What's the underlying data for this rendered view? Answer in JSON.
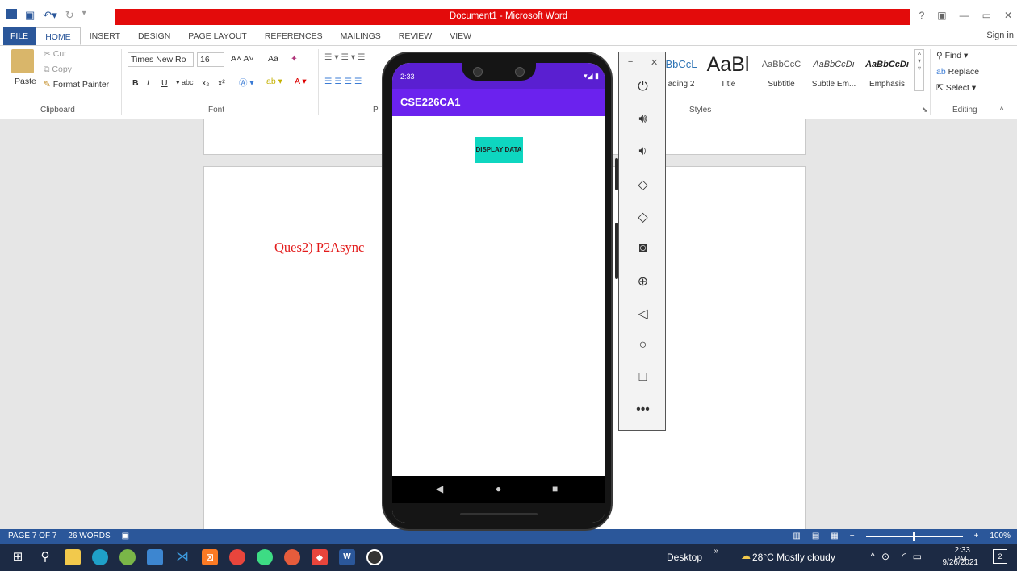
{
  "window": {
    "title": "Document1 - Microsoft Word",
    "sign_in": "Sign in"
  },
  "tabs": [
    "FILE",
    "HOME",
    "INSERT",
    "DESIGN",
    "PAGE LAYOUT",
    "REFERENCES",
    "MAILINGS",
    "REVIEW",
    "VIEW"
  ],
  "clipboard": {
    "paste": "Paste",
    "cut": "Cut",
    "copy": "Copy",
    "format_painter": "Format Painter",
    "label": "Clipboard"
  },
  "font": {
    "name": "Times New Ro",
    "size": "16",
    "label": "Font",
    "case": "Aa"
  },
  "paragraph": {
    "label": "P"
  },
  "styles": {
    "label": "Styles",
    "items": [
      {
        "preview": "BbCcL",
        "name": "ading 2"
      },
      {
        "preview": "AaBl",
        "name": "Title"
      },
      {
        "preview": "AaBbCcC",
        "name": "Subtitle"
      },
      {
        "preview": "AaBbCcDı",
        "name": "Subtle Em..."
      },
      {
        "preview": "AaBbCcDı",
        "name": "Emphasis"
      }
    ]
  },
  "editing": {
    "find": "Find",
    "replace": "Replace",
    "select": "Select",
    "label": "Editing"
  },
  "document": {
    "text": "Ques2) P2Async"
  },
  "status": {
    "page": "PAGE 7 OF 7",
    "words": "26 WORDS",
    "zoom": "100%"
  },
  "phone": {
    "time": "2:33",
    "app_title": "CSE226CA1",
    "button": "DISPLAY DATA"
  },
  "taskbar": {
    "desktop": "Desktop",
    "weather": "28°C  Mostly cloudy",
    "time": "2:33 PM",
    "date": "9/26/2021",
    "notifications": "2"
  },
  "colors": {
    "word_blue": "#2b579a",
    "title_red": "#e30b0b",
    "app_purple": "#6b22ee",
    "button_teal": "#0ed6c0",
    "doc_text_red": "#e31b1b"
  }
}
